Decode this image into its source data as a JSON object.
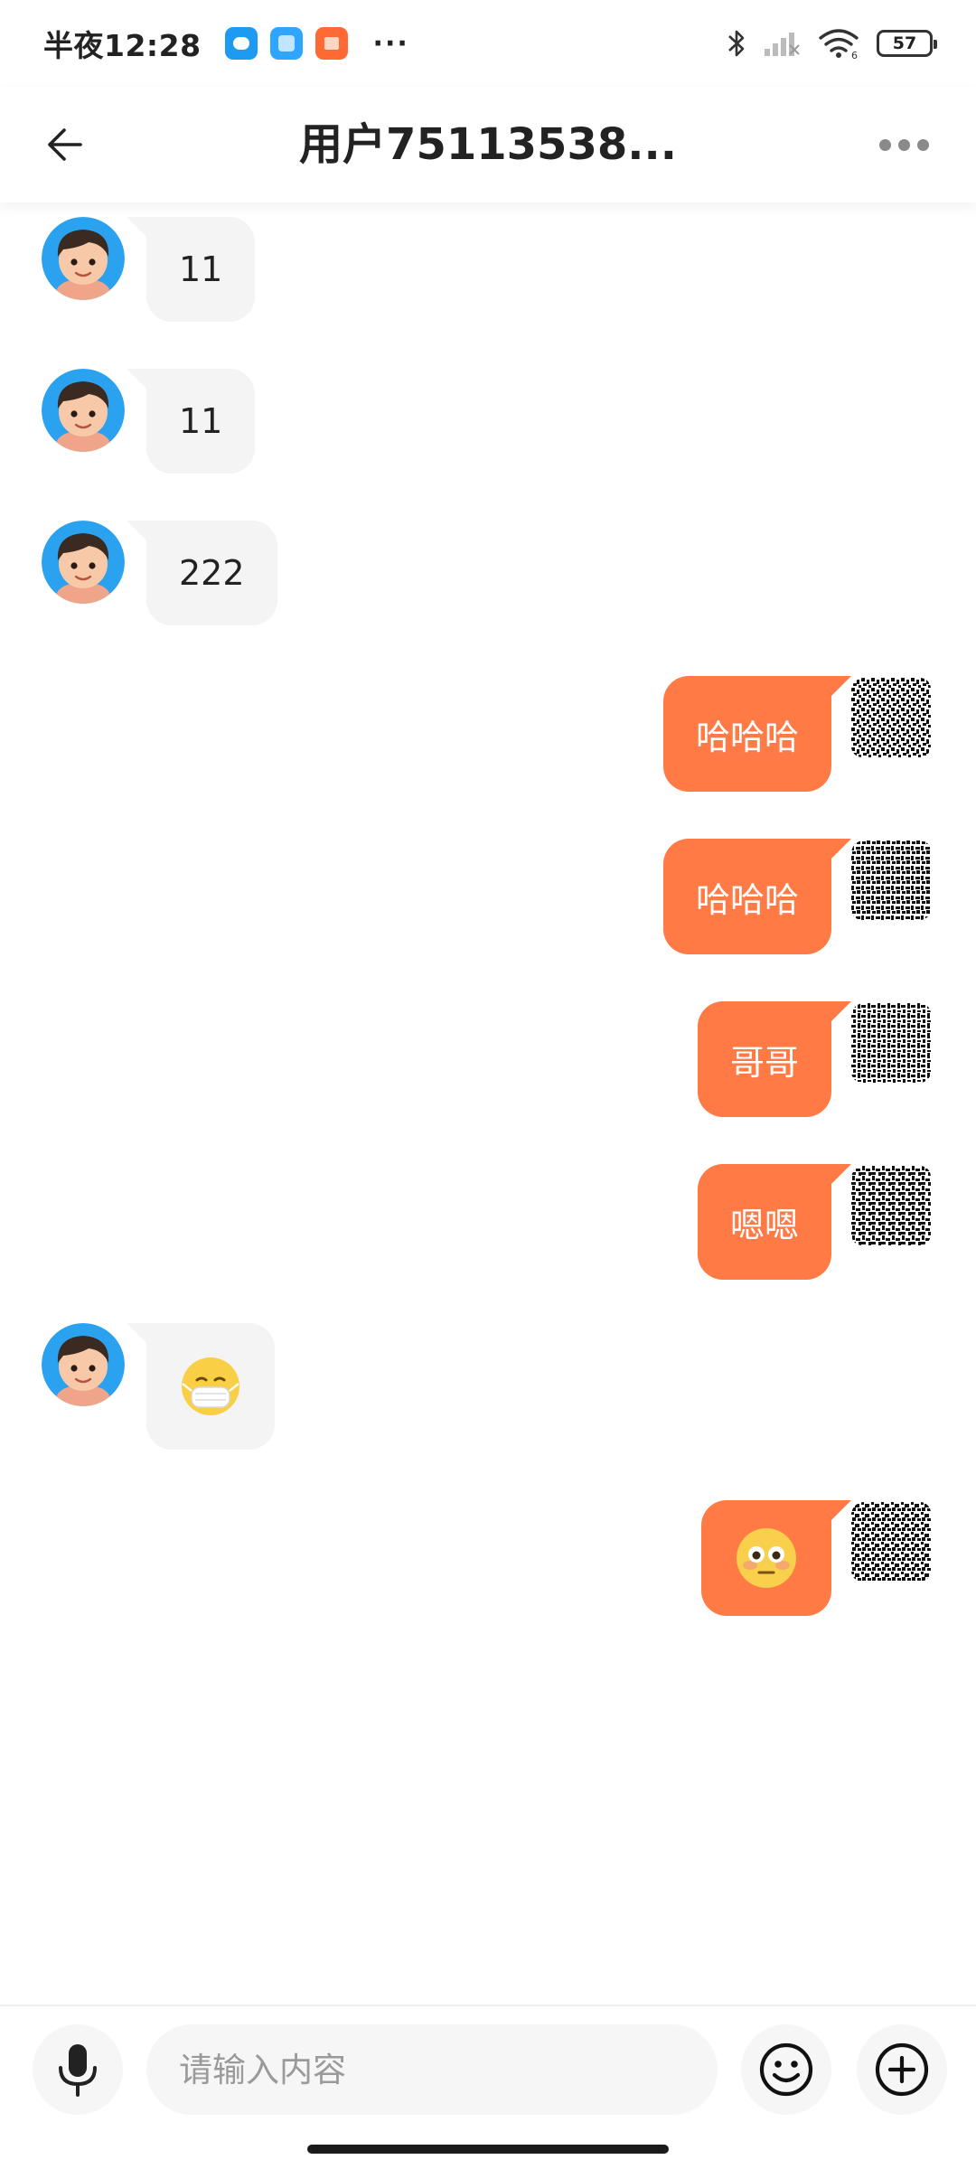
{
  "status_bar": {
    "time": "半夜12:28",
    "more": "···",
    "battery": "57",
    "wifi_badge": "6"
  },
  "header": {
    "title": "用户75113538..."
  },
  "colors": {
    "accent": "#ff7a45",
    "incoming_bubble": "#f4f4f4",
    "incoming_avatar_ring": "#2aa2f0"
  },
  "messages": [
    {
      "side": "left",
      "type": "text",
      "text": "11",
      "avatar": "cartoon-boy-avatar"
    },
    {
      "side": "left",
      "type": "text",
      "text": "11",
      "avatar": "cartoon-boy-avatar"
    },
    {
      "side": "left",
      "type": "text",
      "text": "222",
      "avatar": "cartoon-boy-avatar"
    },
    {
      "side": "right",
      "type": "text",
      "text": "哈哈哈",
      "avatar": "qr-pattern-avatar"
    },
    {
      "side": "right",
      "type": "text",
      "text": "哈哈哈",
      "avatar": "qr-pattern-avatar"
    },
    {
      "side": "right",
      "type": "text",
      "text": "哥哥",
      "avatar": "qr-pattern-avatar"
    },
    {
      "side": "right",
      "type": "text",
      "text": "嗯嗯",
      "avatar": "qr-pattern-avatar"
    },
    {
      "side": "left",
      "type": "emoji",
      "emoji": "face-with-medical-mask",
      "avatar": "cartoon-boy-avatar"
    },
    {
      "side": "right",
      "type": "emoji",
      "emoji": "flushed-face",
      "avatar": "qr-pattern-avatar"
    }
  ],
  "input": {
    "placeholder": "请输入内容"
  },
  "icons": {
    "voice": "microphone-icon",
    "emoji": "smiley-icon",
    "add": "plus-circle-icon",
    "back": "back-arrow-icon",
    "more": "more-dots-icon"
  }
}
